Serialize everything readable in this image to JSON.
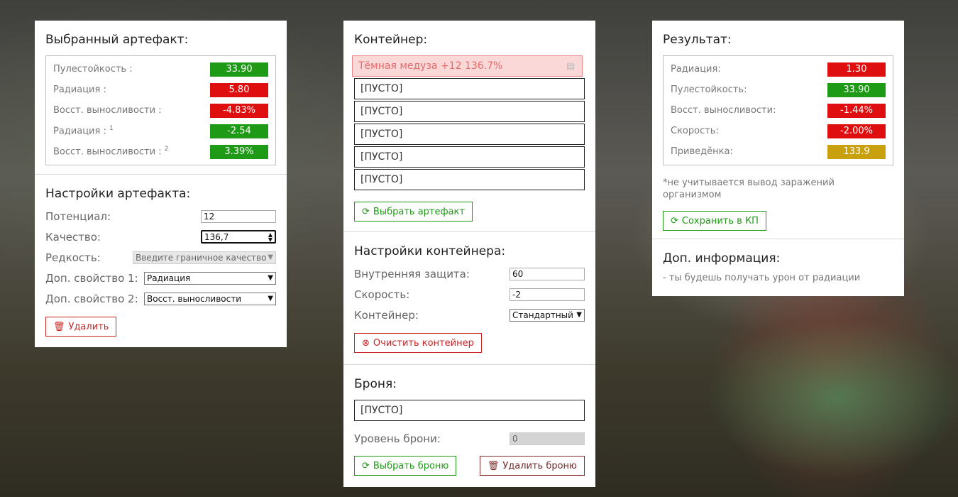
{
  "artifact": {
    "title": "Выбранный артефакт:",
    "stats": [
      {
        "label": "Пулестойкость :",
        "sup": "",
        "value": "33.90",
        "color": "green"
      },
      {
        "label": "Радиация :",
        "sup": "",
        "value": "5.80",
        "color": "red"
      },
      {
        "label": "Восст. выносливости :",
        "sup": "",
        "value": "-4.83%",
        "color": "red"
      },
      {
        "label": "Радиация :",
        "sup": "1",
        "value": "-2.54",
        "color": "green"
      },
      {
        "label": "Восст. выносливости :",
        "sup": "2",
        "value": "3.39%",
        "color": "green"
      }
    ],
    "settings_title": "Настройки артефакта:",
    "potential_label": "Потенциал:",
    "potential_value": "12",
    "quality_label": "Качество:",
    "quality_value": "136,7",
    "rarity_label": "Редкость:",
    "rarity_value": "Введите граничное качество",
    "extra1_label": "Доп. свойство 1:",
    "extra1_value": "Радиация",
    "extra2_label": "Доп. свойство 2:",
    "extra2_value": "Восст. выносливости",
    "delete_label": "Удалить"
  },
  "container": {
    "title": "Контейнер:",
    "slot_filled": "Тёмная медуза +12 136.7%",
    "slots": [
      "[ПУСТО]",
      "[ПУСТО]",
      "[ПУСТО]",
      "[ПУСТО]",
      "[ПУСТО]"
    ],
    "select_label": "Выбрать артефакт",
    "settings_title": "Настройки контейнера:",
    "protection_label": "Внутренняя защита:",
    "protection_value": "60",
    "speed_label": "Скорость:",
    "speed_value": "-2",
    "type_label": "Контейнер:",
    "type_value": "Стандартный",
    "clear_label": "Очистить контейнер"
  },
  "armor": {
    "title": "Броня:",
    "slot": "[ПУСТО]",
    "level_label": "Уровень брони:",
    "level_value": "0",
    "select_label": "Выбрать броню",
    "delete_label": "Удалить броню"
  },
  "result": {
    "title": "Результат:",
    "stats": [
      {
        "label": "Радиация:",
        "value": "1.30",
        "color": "red"
      },
      {
        "label": "Пулестойкость:",
        "value": "33.90",
        "color": "green"
      },
      {
        "label": "Восст. выносливости:",
        "value": "-1.44%",
        "color": "red"
      },
      {
        "label": "Скорость:",
        "value": "-2.00%",
        "color": "red"
      },
      {
        "label": "Приведёнка:",
        "value": "133.9",
        "color": "gold"
      }
    ],
    "note": "*не учитывается вывод заражений организмом",
    "save_label": "Сохранить в КП",
    "info_title": "Доп. информация:",
    "info_text": "- ты будешь получать урон от радиации"
  },
  "colors": {
    "green": "#1f9a16",
    "red": "#e00f0f",
    "gold": "#c9a10f"
  }
}
